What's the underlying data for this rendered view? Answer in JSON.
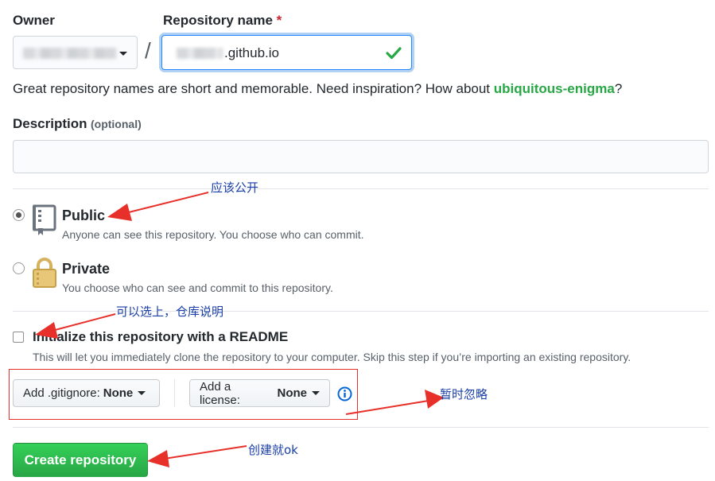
{
  "owner": {
    "label": "Owner"
  },
  "repository": {
    "label": "Repository name",
    "required_mark": "*",
    "value_suffix": ".github.io",
    "separator": "/"
  },
  "hint": {
    "text": "Great repository names are short and memorable. Need inspiration? How about ",
    "suggestion": "ubiquitous-enigma",
    "end": "?"
  },
  "description": {
    "label": "Description",
    "optional": "(optional)",
    "value": ""
  },
  "visibility": {
    "public_title": "Public",
    "public_desc": "Anyone can see this repository. You choose who can commit.",
    "private_title": "Private",
    "private_desc": "You choose who can see and commit to this repository.",
    "selected": "public"
  },
  "readme": {
    "title": "Initialize this repository with a README",
    "desc": "This will let you immediately clone the repository to your computer. Skip this step if you’re importing an existing repository.",
    "checked": false
  },
  "gitignore": {
    "label": "Add .gitignore:",
    "value": "None"
  },
  "license": {
    "label": "Add a license:",
    "value": "None"
  },
  "submit": {
    "label": "Create repository"
  },
  "annotations": {
    "public_note": "应该公开",
    "readme_note": "可以选上，仓库说明",
    "ignore_note": "暂时忽略",
    "create_note": "创建就ok"
  },
  "colors": {
    "accent_green": "#28a745",
    "annotation_red": "#e8302a",
    "annotation_blue": "#1a3ea8"
  }
}
